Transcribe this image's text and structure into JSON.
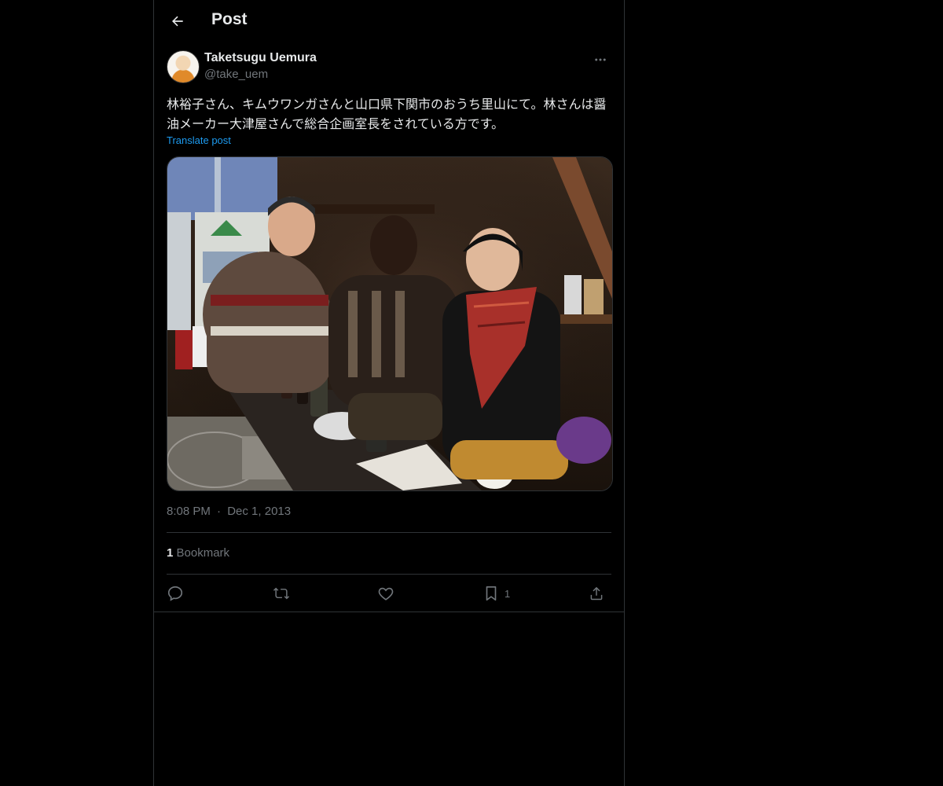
{
  "header": {
    "title": "Post",
    "back_icon": "arrow-left-icon"
  },
  "author": {
    "name": "Taketsugu Uemura",
    "handle": "@take_uem"
  },
  "post": {
    "text": "林裕子さん、キムウワンガさんと山口県下関市のおうち里山にて。林さんは醤油メーカー大津屋さんで総合企画室長をされている方です。",
    "translate_label": "Translate post",
    "time": "8:08 PM",
    "separator": "·",
    "date": "Dec 1, 2013"
  },
  "stats": {
    "bookmark_count": "1",
    "bookmark_label": "Bookmark"
  },
  "actions": {
    "bookmark_count": "1"
  },
  "colors": {
    "background": "#000000",
    "text": "#e7e9ea",
    "muted": "#71767b",
    "accent": "#1d9bf0",
    "border": "#2f3336"
  }
}
